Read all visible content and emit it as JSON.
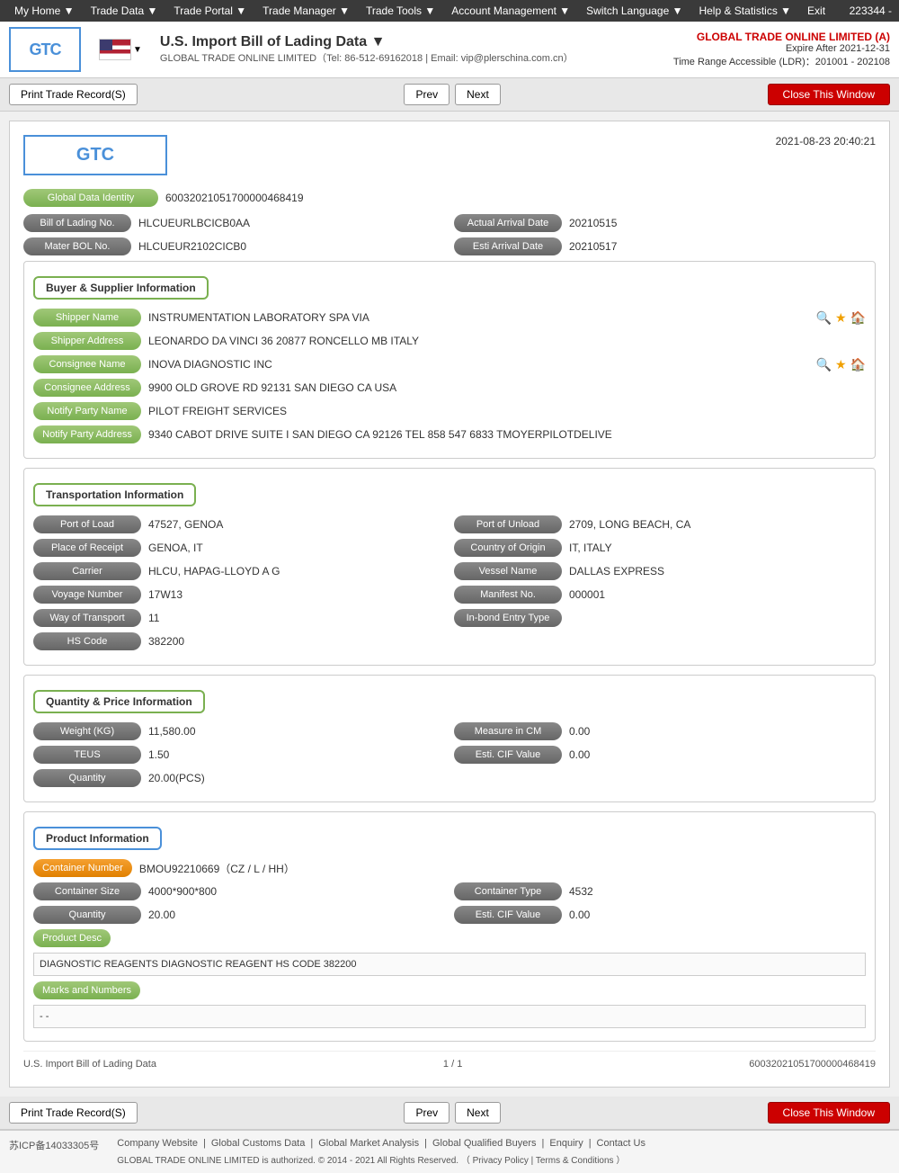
{
  "topnav": {
    "items": [
      {
        "label": "My Home ▼"
      },
      {
        "label": "Trade Data ▼"
      },
      {
        "label": "Trade Portal ▼"
      },
      {
        "label": "Trade Manager ▼"
      },
      {
        "label": "Trade Tools ▼"
      },
      {
        "label": "Account Management ▼"
      },
      {
        "label": "Switch Language ▼"
      },
      {
        "label": "Help & Statistics ▼"
      },
      {
        "label": "Exit"
      }
    ],
    "user_number": "223344 -"
  },
  "header": {
    "logo_text": "GTC",
    "title": "U.S. Import Bill of Lading Data ▼",
    "subtitle": "GLOBAL TRADE ONLINE LIMITED（Tel: 86-512-69162018 | Email: vip@plerschina.com.cn）",
    "company_name": "GLOBAL TRADE ONLINE LIMITED (A)",
    "expire_label": "Expire After 2021-12-31",
    "time_range": "Time Range Accessible (LDR)：201001 - 202108"
  },
  "actions": {
    "print_label": "Print Trade Record(S)",
    "prev_label": "Prev",
    "next_label": "Next",
    "close_label": "Close This Window"
  },
  "document": {
    "logo_text": "GTC",
    "date": "2021-08-23 20:40:21",
    "global_data_identity_label": "Global Data Identity",
    "global_data_identity_value": "60032021051700000468419",
    "bol_no_label": "Bill of Lading No.",
    "bol_no_value": "HLCUEURLBCICB0AA",
    "actual_arrival_date_label": "Actual Arrival Date",
    "actual_arrival_date_value": "20210515",
    "mater_bol_label": "Mater BOL No.",
    "mater_bol_value": "HLCUEUR2102CICB0",
    "esti_arrival_date_label": "Esti Arrival Date",
    "esti_arrival_date_value": "20210517",
    "buyer_supplier_section": "Buyer & Supplier Information",
    "shipper_name_label": "Shipper Name",
    "shipper_name_value": "INSTRUMENTATION LABORATORY SPA VIA",
    "shipper_address_label": "Shipper Address",
    "shipper_address_value": "LEONARDO DA VINCI 36 20877 RONCELLO MB ITALY",
    "consignee_name_label": "Consignee Name",
    "consignee_name_value": "INOVA DIAGNOSTIC INC",
    "consignee_address_label": "Consignee Address",
    "consignee_address_value": "9900 OLD GROVE RD 92131 SAN DIEGO CA USA",
    "notify_party_name_label": "Notify Party Name",
    "notify_party_name_value": "PILOT FREIGHT SERVICES",
    "notify_party_address_label": "Notify Party Address",
    "notify_party_address_value": "9340 CABOT DRIVE SUITE I SAN DIEGO CA 92126 TEL 858 547 6833 TMOYERPILOTDELIVE",
    "transport_section": "Transportation Information",
    "port_of_load_label": "Port of Load",
    "port_of_load_value": "47527, GENOA",
    "port_of_unload_label": "Port of Unload",
    "port_of_unload_value": "2709, LONG BEACH, CA",
    "place_of_receipt_label": "Place of Receipt",
    "place_of_receipt_value": "GENOA, IT",
    "country_of_origin_label": "Country of Origin",
    "country_of_origin_value": "IT, ITALY",
    "carrier_label": "Carrier",
    "carrier_value": "HLCU, HAPAG-LLOYD A G",
    "vessel_name_label": "Vessel Name",
    "vessel_name_value": "DALLAS EXPRESS",
    "voyage_number_label": "Voyage Number",
    "voyage_number_value": "17W13",
    "manifest_no_label": "Manifest No.",
    "manifest_no_value": "000001",
    "way_of_transport_label": "Way of Transport",
    "way_of_transport_value": "11",
    "inbond_entry_type_label": "In-bond Entry Type",
    "inbond_entry_type_value": "",
    "hs_code_label": "HS Code",
    "hs_code_value": "382200",
    "quantity_section": "Quantity & Price Information",
    "weight_label": "Weight (KG)",
    "weight_value": "11,580.00",
    "measure_cm_label": "Measure in CM",
    "measure_cm_value": "0.00",
    "teus_label": "TEUS",
    "teus_value": "1.50",
    "esti_cif_value_label": "Esti. CIF Value",
    "esti_cif_value_value": "0.00",
    "quantity_label": "Quantity",
    "quantity_value": "20.00(PCS)",
    "product_section": "Product Information",
    "container_number_label": "Container Number",
    "container_number_value": "BMOU92210669（CZ / L / HH）",
    "container_size_label": "Container Size",
    "container_size_value": "4000*900*800",
    "container_type_label": "Container Type",
    "container_type_value": "4532",
    "qty_product_label": "Quantity",
    "qty_product_value": "20.00",
    "esti_cif_product_label": "Esti. CIF Value",
    "esti_cif_product_value": "0.00",
    "product_desc_label": "Product Desc",
    "product_desc_value": "DIAGNOSTIC REAGENTS DIAGNOSTIC REAGENT HS CODE 382200",
    "marks_numbers_label": "Marks and Numbers",
    "marks_numbers_value": "- -",
    "doc_footer_left": "U.S. Import Bill of Lading Data",
    "doc_footer_center": "1 / 1",
    "doc_footer_right": "60032021051700000468419"
  },
  "footer": {
    "icp": "苏ICP备14033305号",
    "links": [
      "Company Website",
      "Global Customs Data",
      "Global Market Analysis",
      "Global Qualified Buyers",
      "Enquiry",
      "Contact Us"
    ],
    "copyright": "GLOBAL TRADE ONLINE LIMITED is authorized. © 2014 - 2021 All Rights Reserved.",
    "privacy_label": "Privacy Policy",
    "terms_label": "Terms & Conditions"
  }
}
